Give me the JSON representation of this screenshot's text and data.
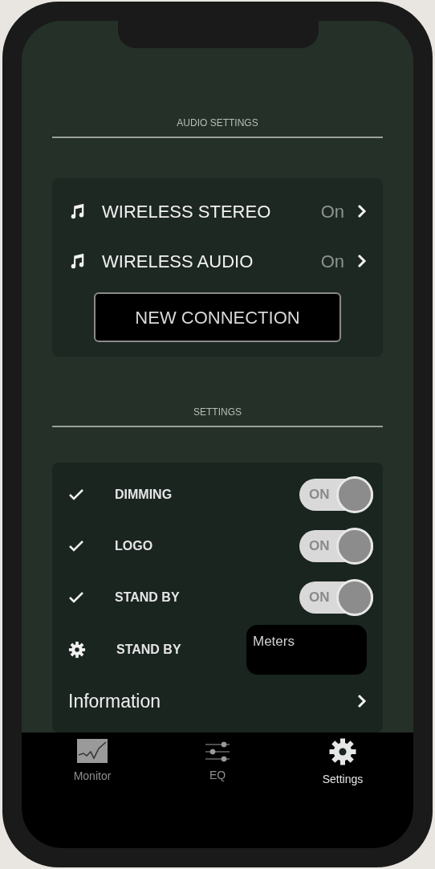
{
  "audio_settings": {
    "heading": "AUDIO SETTINGS",
    "items": [
      {
        "label": "WIRELESS STEREO",
        "value": "On"
      },
      {
        "label": "WIRELESS AUDIO",
        "value": "On"
      }
    ],
    "button": "NEW CONNECTION"
  },
  "settings": {
    "heading": "SETTINGS",
    "items": [
      {
        "kind": "toggle",
        "label": "DIMMING",
        "on": true,
        "toggle_text": "ON"
      },
      {
        "kind": "toggle",
        "label": "LOGO",
        "on": true,
        "toggle_text": "ON"
      },
      {
        "kind": "toggle",
        "label": "STAND BY",
        "on": true,
        "toggle_text": "ON"
      },
      {
        "kind": "select",
        "label": "STAND BY",
        "value": "Meters"
      },
      {
        "kind": "link",
        "label": "Information"
      }
    ]
  },
  "tabs": [
    {
      "label": "Monitor",
      "kind": "chart",
      "selected": false
    },
    {
      "label": "EQ",
      "kind": "sliders",
      "selected": false
    },
    {
      "label": "Settings",
      "kind": "gear",
      "selected": true
    }
  ]
}
